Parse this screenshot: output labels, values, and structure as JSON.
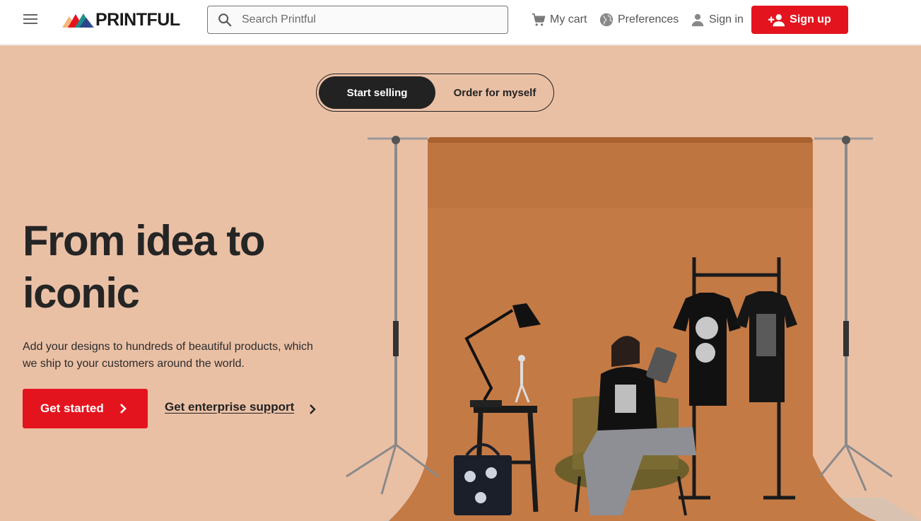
{
  "header": {
    "logo_text": "PRINTFUL",
    "search_placeholder": "Search Printful",
    "cart_label": "My cart",
    "preferences_label": "Preferences",
    "signin_label": "Sign in",
    "signup_label": "Sign up",
    "icons": [
      "menu-icon",
      "search-icon",
      "cart-icon",
      "globe-icon",
      "person-icon",
      "add-person-icon"
    ]
  },
  "hero": {
    "toggle_active": "Start selling",
    "toggle_inactive": "Order for myself",
    "headline_line1": "From idea to",
    "headline_line2": "iconic",
    "subtext": "Add your designs to hundreds of beautiful products, which we ship to your customers around the world.",
    "cta_primary": "Get started",
    "cta_secondary": "Get enterprise support"
  },
  "colors": {
    "brand_red": "#e4141e",
    "hero_bg": "#eac0a5",
    "backdrop": "#c47a45",
    "dark": "#222222"
  }
}
